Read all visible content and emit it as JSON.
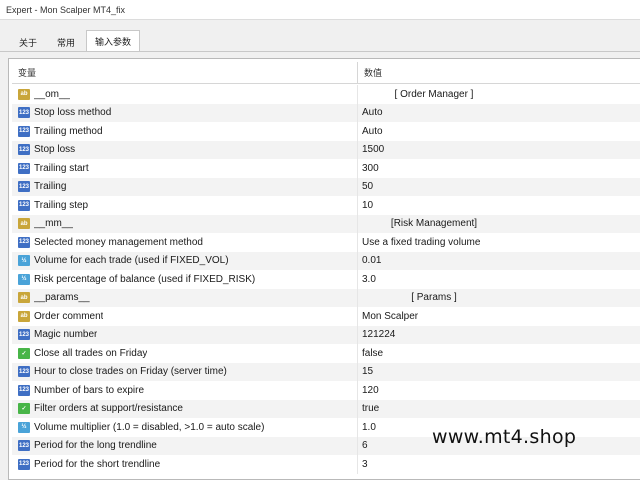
{
  "window": {
    "title": "Expert - Mon Scalper MT4_fix"
  },
  "tabs": [
    {
      "label": "关于"
    },
    {
      "label": "常用"
    },
    {
      "label": "输入参数"
    }
  ],
  "table": {
    "header_variable": "变量",
    "header_value": "数值",
    "rows": [
      {
        "icon": "ab",
        "name": "__om__",
        "value": "[ Order Manager ]",
        "section": true
      },
      {
        "icon": "123",
        "name": "Stop loss method",
        "value": "Auto"
      },
      {
        "icon": "123",
        "name": "Trailing method",
        "value": "Auto"
      },
      {
        "icon": "123",
        "name": "Stop loss",
        "value": "1500"
      },
      {
        "icon": "123",
        "name": "Trailing start",
        "value": "300"
      },
      {
        "icon": "123",
        "name": "Trailing",
        "value": "50"
      },
      {
        "icon": "123",
        "name": "Trailing step",
        "value": "10"
      },
      {
        "icon": "ab",
        "name": "__mm__",
        "value": "[Risk Management]",
        "section": true
      },
      {
        "icon": "123",
        "name": "Selected money management method",
        "value": "Use a fixed trading volume"
      },
      {
        "icon": "v2",
        "name": "Volume for each trade (used if FIXED_VOL)",
        "value": "0.01"
      },
      {
        "icon": "v2",
        "name": "Risk percentage of balance (used if FIXED_RISK)",
        "value": "3.0"
      },
      {
        "icon": "ab",
        "name": "__params__",
        "value": "[ Params ]",
        "section": true
      },
      {
        "icon": "ab",
        "name": "Order comment",
        "value": "Mon Scalper"
      },
      {
        "icon": "123",
        "name": "Magic number",
        "value": "121224"
      },
      {
        "icon": "bool",
        "name": "Close all trades on Friday",
        "value": "false"
      },
      {
        "icon": "123",
        "name": "Hour to close trades on Friday (server time)",
        "value": "15"
      },
      {
        "icon": "123",
        "name": "Number of bars to expire",
        "value": "120"
      },
      {
        "icon": "bool",
        "name": "Filter orders at support/resistance",
        "value": "true"
      },
      {
        "icon": "v2",
        "name": "Volume multiplier (1.0 = disabled, >1.0 = auto scale)",
        "value": "1.0"
      },
      {
        "icon": "123",
        "name": "Period for the long trendline",
        "value": "6"
      },
      {
        "icon": "123",
        "name": "Period for the short trendline",
        "value": "3"
      }
    ]
  },
  "watermark": "www.mt4.shop"
}
